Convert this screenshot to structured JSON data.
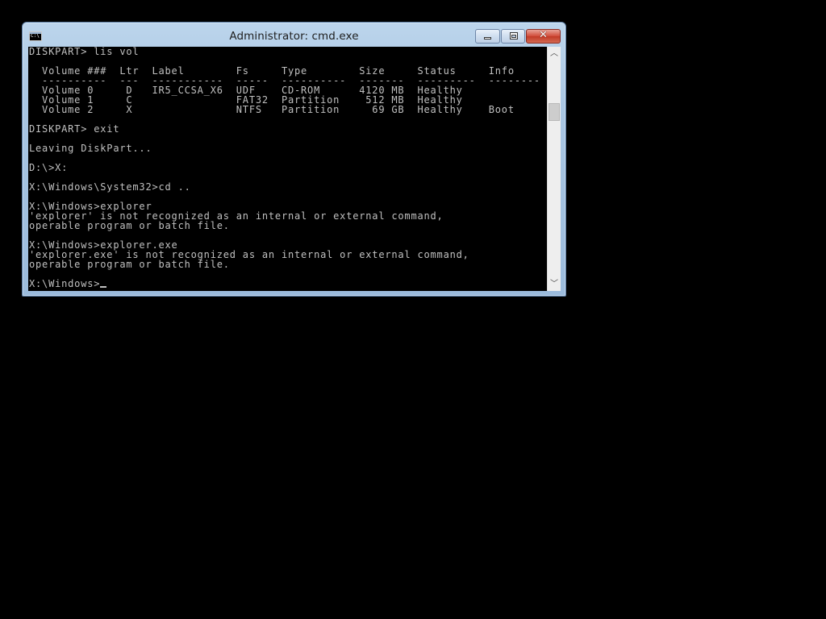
{
  "window": {
    "title": "Administrator: cmd.exe",
    "icon_text": "C:\\",
    "icon_name": "cmd-icon"
  },
  "caption_buttons": {
    "minimize": "minimize-icon",
    "maximize": "maximize-icon",
    "close_glyph": "✕"
  },
  "scrollbar": {
    "up_glyph": "︿",
    "down_glyph": "﹀"
  },
  "console": {
    "lines": [
      "DISKPART> lis vol",
      "",
      "  Volume ###  Ltr  Label        Fs     Type        Size     Status     Info",
      "  ----------  ---  -----------  -----  ----------  -------  ---------  --------",
      "  Volume 0     D   IR5_CCSA_X6  UDF    CD-ROM      4120 MB  Healthy",
      "  Volume 1     C                FAT32  Partition    512 MB  Healthy",
      "  Volume 2     X                NTFS   Partition     69 GB  Healthy    Boot",
      "",
      "DISKPART> exit",
      "",
      "Leaving DiskPart...",
      "",
      "D:\\>X:",
      "",
      "X:\\Windows\\System32>cd ..",
      "",
      "X:\\Windows>explorer",
      "'explorer' is not recognized as an internal or external command,",
      "operable program or batch file.",
      "",
      "X:\\Windows>explorer.exe",
      "'explorer.exe' is not recognized as an internal or external command,",
      "operable program or batch file.",
      ""
    ],
    "prompt": "X:\\Windows>"
  },
  "colors": {
    "console_bg": "#000000",
    "console_fg": "#c0c0c0",
    "frame": "#a9c6e3",
    "close_button": "#c23a27"
  }
}
